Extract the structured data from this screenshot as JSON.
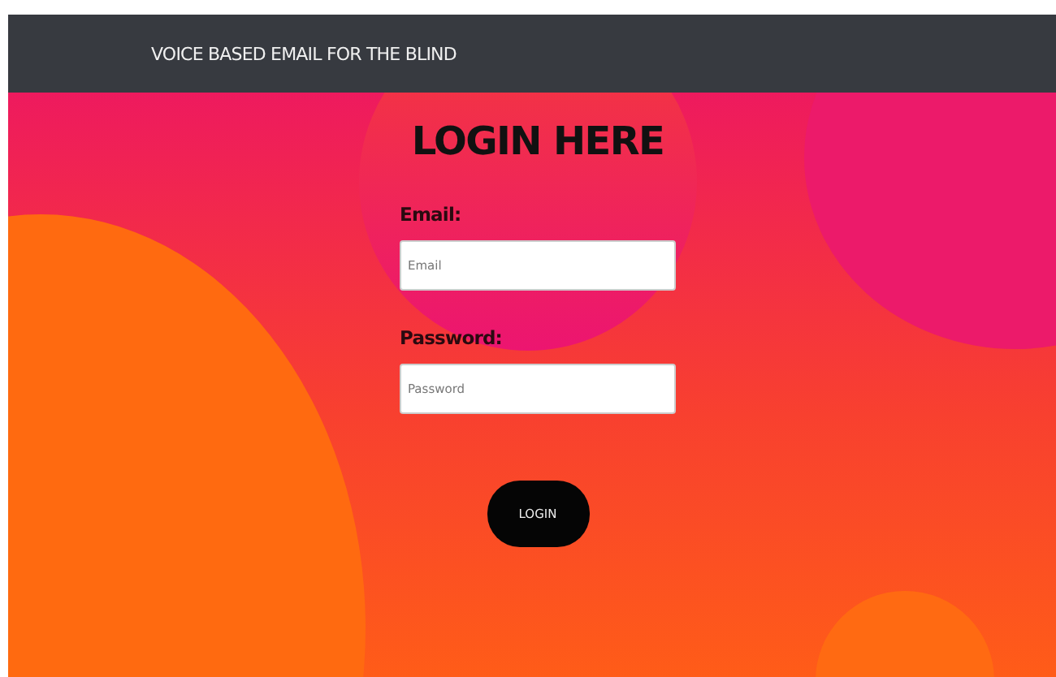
{
  "navbar": {
    "title": "VOICE BASED EMAIL FOR THE BLIND"
  },
  "login_form": {
    "heading": "LOGIN HERE",
    "fields": [
      {
        "label": "Email:",
        "placeholder": "Email"
      },
      {
        "label": "Password:",
        "placeholder": "Password"
      }
    ],
    "button": "LOGIN"
  }
}
